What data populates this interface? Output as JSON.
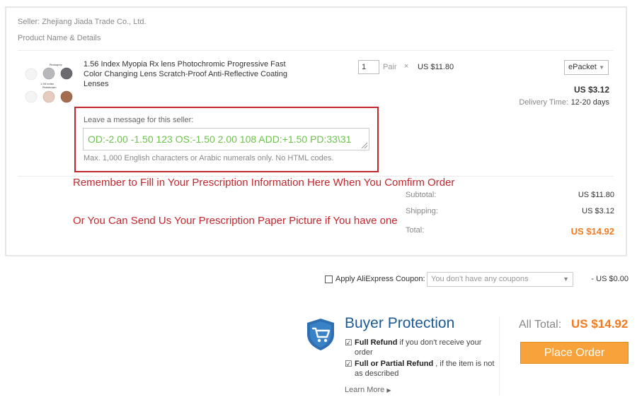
{
  "seller": "Seller: Zhejiang Jiada Trade Co., Ltd.",
  "product_section_label": "Product Name & Details",
  "product": {
    "title": "1.56 Index Myopia Rx lens Photochromic Progressive Fast Color Changing Lens Scratch-Proof Anti-Reflective Coating Lenses",
    "thumbnail_labels": [
      "Photogrey",
      "1.56 index",
      "Photobrown"
    ],
    "quantity": "1",
    "unit": "Pair",
    "times_symbol": "×",
    "unit_price": "US $11.80",
    "shipping_method": "ePacket",
    "shipping_cost": "US $3.12",
    "delivery_label": "Delivery Time:",
    "delivery_value": "12-20 days"
  },
  "message": {
    "label": "Leave a message for this seller:",
    "value": "OD:-2.00 -1.50 123 OS:-1.50 2.00 108 ADD:+1.50 PD:33\\31",
    "hint": "Max. 1,000 English characters or Arabic numerals only. No HTML codes."
  },
  "annotations": {
    "line1": "Remember to Fill in Your Prescription Information Here When You Comfirm Order",
    "line2": "Or You Can Send Us Your Prescription Paper Picture if You have one"
  },
  "summary": {
    "subtotal_label": "Subtotal:",
    "subtotal_value": "US $11.80",
    "shipping_label": "Shipping:",
    "shipping_value": "US $3.12",
    "total_label": "Total:",
    "total_value": "US $14.92"
  },
  "coupon": {
    "label": "Apply AliExpress Coupon:",
    "select_value": "You don't have any coupons",
    "discount": "- US $0.00"
  },
  "buyer_protection": {
    "title": "Buyer Protection",
    "item1_bold": "Full Refund",
    "item1_rest": " if you don't receive your order",
    "item2_bold": "Full or Partial Refund",
    "item2_rest": " , if the item is not as described",
    "learn_more": "Learn More"
  },
  "checkout": {
    "all_total_label": "All Total:",
    "all_total_value": "US $14.92",
    "place_order_label": "Place Order"
  },
  "colors": {
    "accent_orange": "#f47a20",
    "button_orange": "#f7a23a",
    "annotation_red": "#c1272d",
    "protection_blue": "#1c5a96",
    "message_green": "#6cc24a"
  }
}
